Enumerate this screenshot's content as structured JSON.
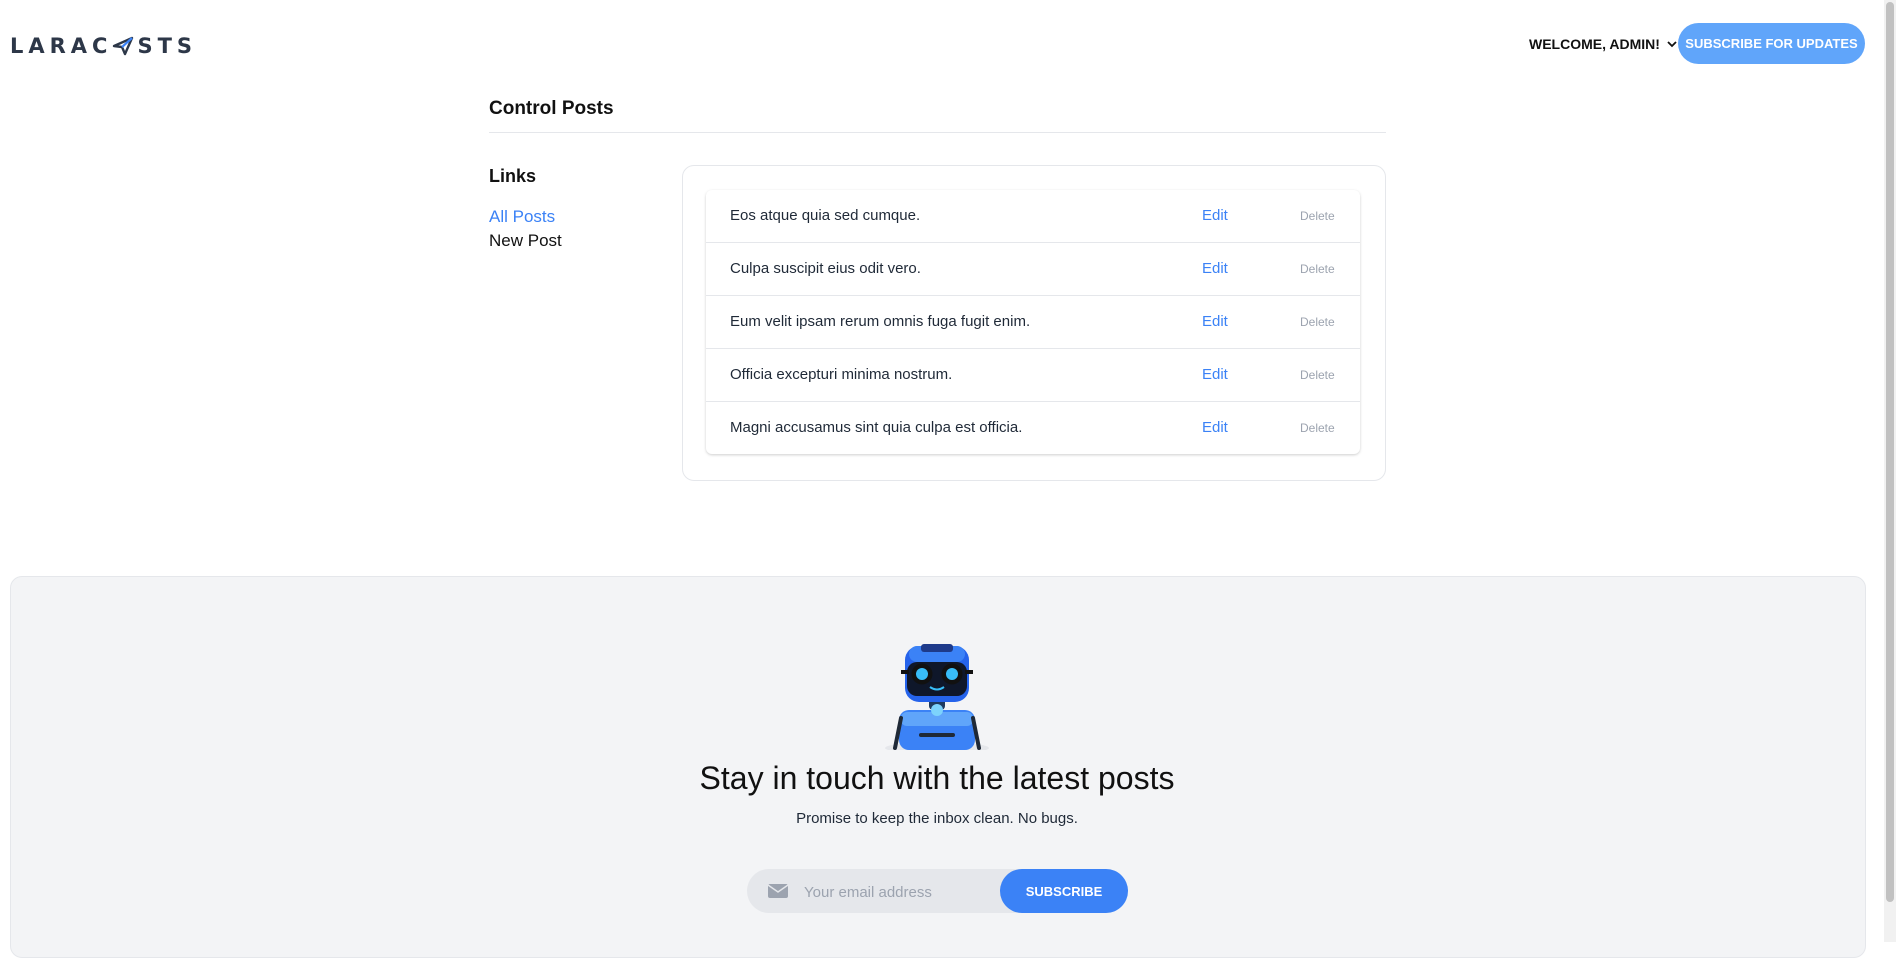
{
  "header": {
    "logo_part1": "LARAC",
    "logo_part2": "STS",
    "welcome": "WELCOME, ADMIN!",
    "subscribe_label": "SUBSCRIBE FOR UPDATES"
  },
  "page": {
    "title": "Control Posts"
  },
  "sidebar": {
    "heading": "Links",
    "items": [
      {
        "label": "All Posts"
      },
      {
        "label": "New Post"
      }
    ]
  },
  "posts": [
    {
      "title": "Eos atque quia sed cumque.",
      "edit": "Edit",
      "delete": "Delete"
    },
    {
      "title": "Culpa suscipit eius odit vero.",
      "edit": "Edit",
      "delete": "Delete"
    },
    {
      "title": "Eum velit ipsam rerum omnis fuga fugit enim.",
      "edit": "Edit",
      "delete": "Delete"
    },
    {
      "title": "Officia excepturi minima nostrum.",
      "edit": "Edit",
      "delete": "Delete"
    },
    {
      "title": "Magni accusamus sint quia culpa est officia.",
      "edit": "Edit",
      "delete": "Delete"
    }
  ],
  "newsletter": {
    "heading": "Stay in touch with the latest posts",
    "subheading": "Promise to keep the inbox clean. No bugs.",
    "email_placeholder": "Your email address",
    "subscribe_label": "SUBSCRIBE"
  },
  "colors": {
    "accent": "#3b82f6",
    "accent_light": "#60a5fa",
    "panel_bg": "#f3f4f6"
  }
}
